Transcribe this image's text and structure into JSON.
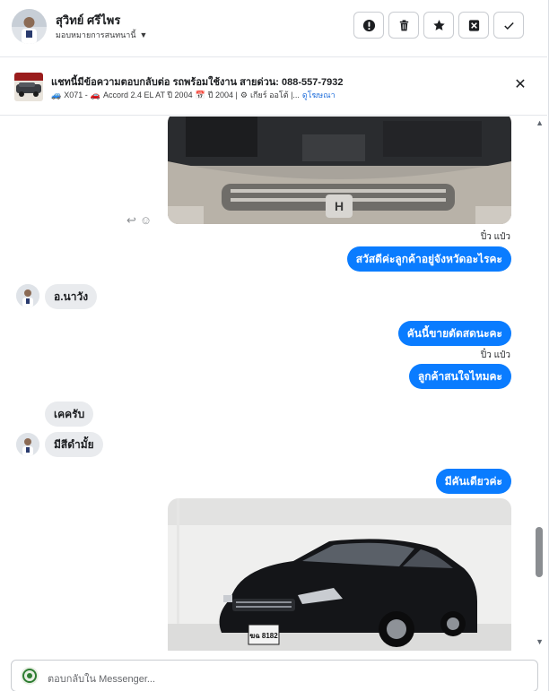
{
  "header": {
    "contact_name": "สุวิทย์ ศรีไพร",
    "assign_label": "มอบหมายการสนทนานี้",
    "actions": [
      {
        "name": "mark-spam-button",
        "icon": "exclamation-icon"
      },
      {
        "name": "delete-button",
        "icon": "trash-icon"
      },
      {
        "name": "star-button",
        "icon": "star-icon"
      },
      {
        "name": "mark-unread-button",
        "icon": "mail-x-icon"
      },
      {
        "name": "mark-done-button",
        "icon": "check-icon"
      }
    ]
  },
  "banner": {
    "title": "แชทนี้มีข้อความตอบกลับต่อ รถพร้อมใช้งาน สายด่วน: 088-557-7932",
    "meta_code": "X071 -",
    "meta_model": "Accord 2.4 EL AT ปี 2004",
    "meta_year": "ปี 2004 |",
    "meta_gear": "เกียร์ ออโต้ |...",
    "meta_link": "ดูโฆษณา"
  },
  "thread": {
    "seen_1": "ปิ๋ว แป๋ว",
    "msg_out_1": "สวัสดีค่ะลูกค้าอยู่จังหวัดอะไรคะ",
    "msg_in_1": "อ.นาวัง",
    "msg_out_2": "คันนี้ขายตัดสดนะคะ",
    "seen_2": "ปิ๋ว แป๋ว",
    "msg_out_3": "ลูกค้าสนใจไหมคะ",
    "msg_in_2": "เคครับ",
    "msg_in_3": "มีสีดำมั้ย",
    "msg_out_4": "มีคันเดียวค่ะ",
    "plate_text": "ฆฉ 8182"
  },
  "composer": {
    "placeholder": "ตอบกลับใน Messenger..."
  },
  "colors": {
    "accent": "#0a7cff",
    "incoming_bubble": "#e9ebee",
    "link": "#216fdb"
  }
}
